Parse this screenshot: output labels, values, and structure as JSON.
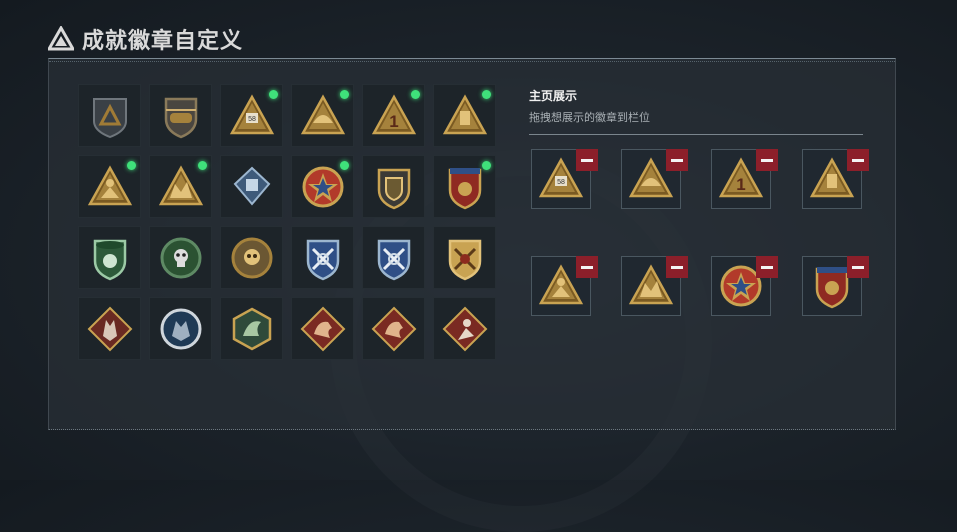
{
  "page": {
    "title": "成就徽章自定义"
  },
  "showcase": {
    "title": "主页展示",
    "subtitle": "拖拽想展示的徽章到栏位",
    "slots": [
      {
        "badge": "triangle-58-badge-icon"
      },
      {
        "badge": "triangle-helmet-badge-icon"
      },
      {
        "badge": "triangle-number-one-badge-icon"
      },
      {
        "badge": "triangle-canister-badge-icon"
      },
      {
        "badge": "triangle-soldier-badge-icon"
      },
      {
        "badge": "triangle-squad-badge-icon"
      },
      {
        "badge": "star-medal-badge-icon"
      },
      {
        "badge": "crest-shield-badge-icon"
      }
    ]
  },
  "badges": [
    {
      "icon": "grey-shield-badge-icon",
      "new": false
    },
    {
      "icon": "helicopter-shield-badge-icon",
      "new": false
    },
    {
      "icon": "triangle-58-badge-icon",
      "new": true
    },
    {
      "icon": "triangle-helmet-badge-icon",
      "new": true
    },
    {
      "icon": "triangle-number-one-badge-icon",
      "new": true
    },
    {
      "icon": "triangle-canister-badge-icon",
      "new": true
    },
    {
      "icon": "triangle-soldier-badge-icon",
      "new": true
    },
    {
      "icon": "triangle-squad-badge-icon",
      "new": true
    },
    {
      "icon": "blue-diamond-badge-icon",
      "new": false
    },
    {
      "icon": "star-medal-badge-icon",
      "new": true
    },
    {
      "icon": "gold-shield-badge-icon",
      "new": false
    },
    {
      "icon": "crest-shield-badge-icon",
      "new": true
    },
    {
      "icon": "green-beret-shield-badge-icon",
      "new": false
    },
    {
      "icon": "green-skull-badge-icon",
      "new": false
    },
    {
      "icon": "gold-skull-badge-icon",
      "new": false
    },
    {
      "icon": "blue-crossed-rifles-badge-icon",
      "new": false
    },
    {
      "icon": "blue-wreath-rifles-badge-icon",
      "new": false
    },
    {
      "icon": "gold-crossed-rifles-badge-icon",
      "new": false
    },
    {
      "icon": "red-wolf-diamond-badge-icon",
      "new": false
    },
    {
      "icon": "blue-wolf-circle-badge-icon",
      "new": false
    },
    {
      "icon": "green-dragon-hexagon-badge-icon",
      "new": false
    },
    {
      "icon": "red-dragon-diamond-badge-icon",
      "new": false
    },
    {
      "icon": "red-beast-diamond-badge-icon",
      "new": false
    },
    {
      "icon": "red-soldier-diamond-badge-icon",
      "new": false
    }
  ],
  "colors": {
    "accent_green": "#3fe07a",
    "remove_red": "#8c1f2a",
    "gold": "#c9a352",
    "panel": "#282f36"
  }
}
